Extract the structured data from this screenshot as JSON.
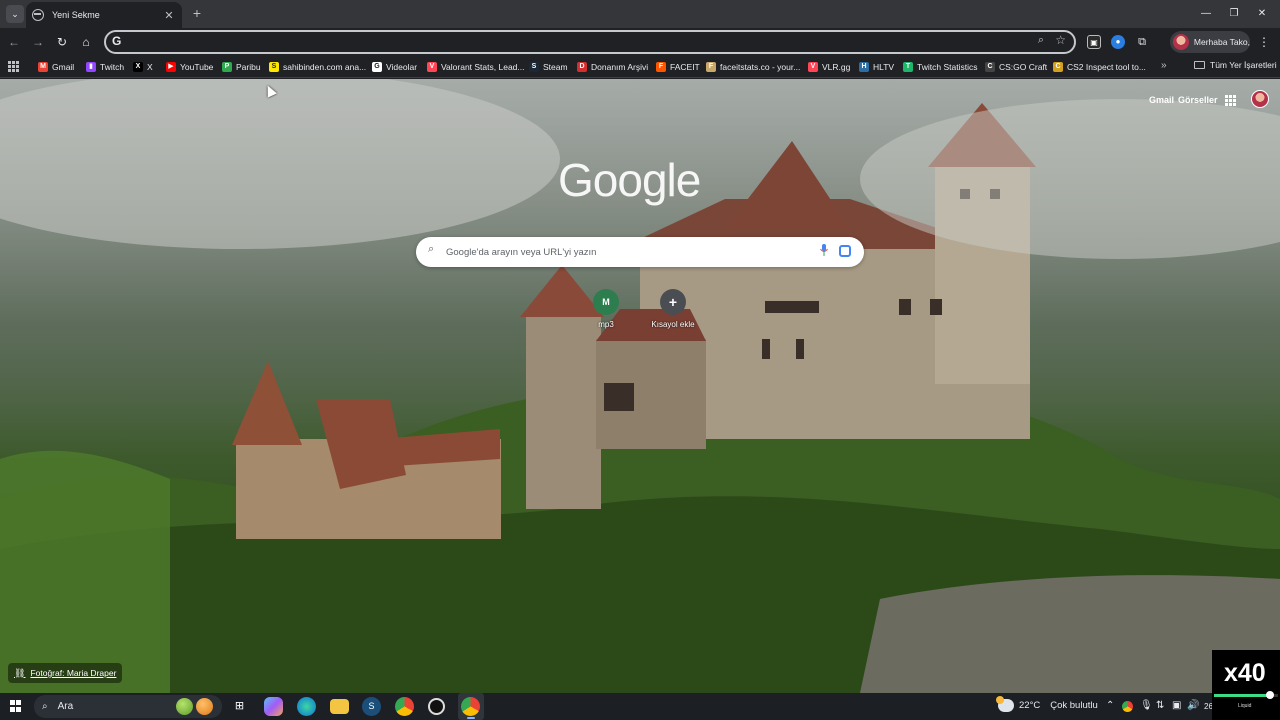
{
  "tabs": [
    {
      "title": "Yeni Sekme"
    }
  ],
  "window_controls": {
    "minimize": "—",
    "restore": "❐",
    "close": "✕"
  },
  "toolbar": {
    "back": "←",
    "forward": "→",
    "reload": "↻",
    "home": "⌂",
    "omnibox_value": "",
    "profile_name": "Merhaba Tako,"
  },
  "bookmarks": [
    {
      "label": "Gmail",
      "icon": "gmail-icon",
      "color": "#ea4335",
      "glyph": "M"
    },
    {
      "label": "Twitch",
      "icon": "twitch-icon",
      "color": "#9146ff",
      "glyph": "▮"
    },
    {
      "label": "X",
      "icon": "x-icon",
      "color": "#000000",
      "glyph": "X"
    },
    {
      "label": "YouTube",
      "icon": "youtube-icon",
      "color": "#ff0000",
      "glyph": "▶"
    },
    {
      "label": "Paribu",
      "icon": "paribu-icon",
      "color": "#2fa84f",
      "glyph": "P"
    },
    {
      "label": "sahibinden.com ana...",
      "icon": "sahibinden-icon",
      "color": "#ffe800",
      "glyph": "S"
    },
    {
      "label": "Videolar",
      "icon": "google-icon",
      "color": "#ffffff",
      "glyph": "G"
    },
    {
      "label": "Valorant Stats, Lead...",
      "icon": "valorant-icon",
      "color": "#ff4655",
      "glyph": "V"
    },
    {
      "label": "Steam",
      "icon": "steam-icon",
      "color": "#1b2838",
      "glyph": "S"
    },
    {
      "label": "Donanım Arşivi",
      "icon": "donanim-icon",
      "color": "#d32f2f",
      "glyph": "D"
    },
    {
      "label": "FACEIT",
      "icon": "faceit-icon",
      "color": "#ff5500",
      "glyph": "F"
    },
    {
      "label": "faceitstats.co - your...",
      "icon": "faceitstats-icon",
      "color": "#c8a96a",
      "glyph": "F"
    },
    {
      "label": "VLR.gg",
      "icon": "vlr-icon",
      "color": "#ff4655",
      "glyph": "V"
    },
    {
      "label": "HLTV",
      "icon": "hltv-icon",
      "color": "#2d6da3",
      "glyph": "H"
    },
    {
      "label": "Twitch Statistics",
      "icon": "twitchstats-icon",
      "color": "#1fb56b",
      "glyph": "T"
    },
    {
      "label": "CS:GO Craft",
      "icon": "csgocraft-icon",
      "color": "#444444",
      "glyph": "C"
    },
    {
      "label": "CS2 Inspect tool to...",
      "icon": "cs2inspect-icon",
      "color": "#d4a020",
      "glyph": "C"
    }
  ],
  "bookmarks_more": "»",
  "all_bookmarks": "Tüm Yer İşaretleri",
  "ntp": {
    "gmail_link": "Gmail",
    "images_link": "Görseller",
    "logo": "Google",
    "search_placeholder": "Google'da arayın veya URL'yi yazın",
    "shortcuts": [
      {
        "label": "mp3",
        "glyph": "M",
        "color": "#2e7d4f"
      },
      {
        "label": "Kısayol ekle",
        "glyph": "+",
        "color": "#4a4d52"
      }
    ],
    "photo_credit": "Fotoğraf: Maria Draper"
  },
  "taskbar": {
    "search_label": "Ara",
    "weather_temp": "22°C",
    "weather_text": "Çok bulutlu",
    "date_fragment": "26"
  },
  "overlay": {
    "speed": "x40",
    "progress": 0.88,
    "brand": "Liquid"
  }
}
